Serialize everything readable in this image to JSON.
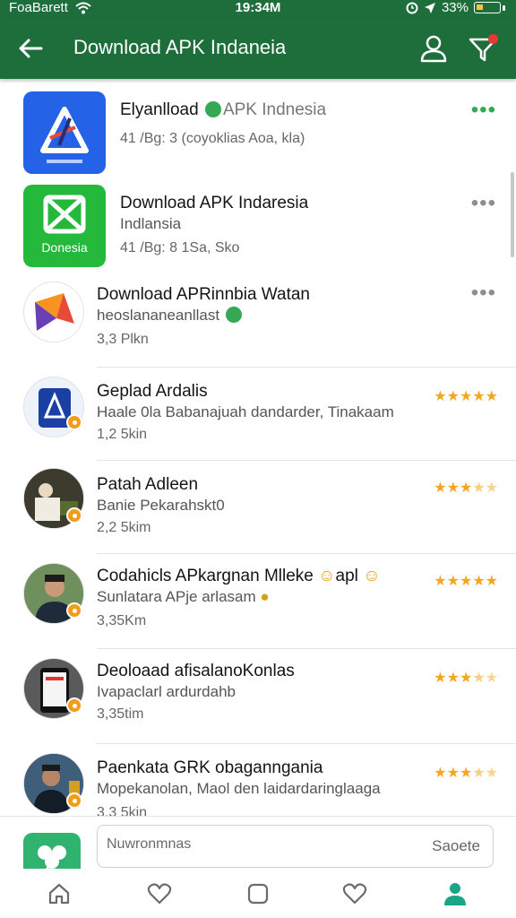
{
  "status_bar": {
    "carrier": "FoaBarett",
    "time": "19:34M",
    "battery": "33%"
  },
  "app_bar": {
    "title": "Download APK Indaneia"
  },
  "colors": {
    "primary": "#1e6e3c",
    "accent_green": "#34a853",
    "star": "#f4a621",
    "badge_orange": "#f29b1c",
    "notification_dot": "#e53935"
  },
  "apps": [
    {
      "icon": "triangle-logo-blue-icon",
      "title": "Elyanlload",
      "badge_text": "APK Indnesia",
      "meta": "41 /Bg: 3  (coyoklias Aoa, kla)",
      "menu": "•••"
    },
    {
      "icon": "envelope-logo-green-icon",
      "icon_caption": "Donesia",
      "title": "Download APK Indaresia",
      "subtitle": "Indlansia",
      "meta": "41 /Bg: 8 1Sa, Sko",
      "menu": "•••"
    },
    {
      "icon": "orange-purple-logo-icon",
      "title": "Download APRinnbia Watan",
      "subtitle": "heoslananeanllast",
      "meta": "3,3 Plkn",
      "menu": "•••"
    },
    {
      "icon": "phone-app-icon",
      "title": "Geplad Ardalis",
      "subtitle": "Haale 0la Babanajuah dandarder, Tinakaam",
      "meta": "1,2 5kin",
      "rating": 5
    },
    {
      "icon": "person-avatar-icon",
      "title": "Patah Adleen",
      "subtitle": "Banie Pekarahskt0",
      "meta": "2,2 5kim",
      "rating": 3.5
    },
    {
      "icon": "man-portrait-icon",
      "title": "Codahicls APkargnan Mlleke",
      "title_suffix": "apl",
      "subtitle": "Sunlatara APje arlasam",
      "meta": "3,35Km",
      "rating": 5
    },
    {
      "icon": "smartphone-screen-icon",
      "title": "Deoloaad afisalanoKonlas",
      "subtitle": "Ivapaclarl ardurdahb",
      "meta": "3,35tim",
      "rating": 3.5
    },
    {
      "icon": "man-in-suit-icon",
      "title": "Paenkata GRK obaganngania",
      "subtitle": "Mopekanolan, Maol den laidardaringlaaga",
      "meta": "3,3 5kin",
      "rating": 3.5
    }
  ],
  "search": {
    "placeholder": "Nuwronmnas",
    "button": "Saoete"
  },
  "bottom_nav": [
    {
      "icon": "home-icon"
    },
    {
      "icon": "heart-icon"
    },
    {
      "icon": "square-icon"
    },
    {
      "icon": "heart-icon"
    },
    {
      "icon": "user-icon"
    }
  ]
}
